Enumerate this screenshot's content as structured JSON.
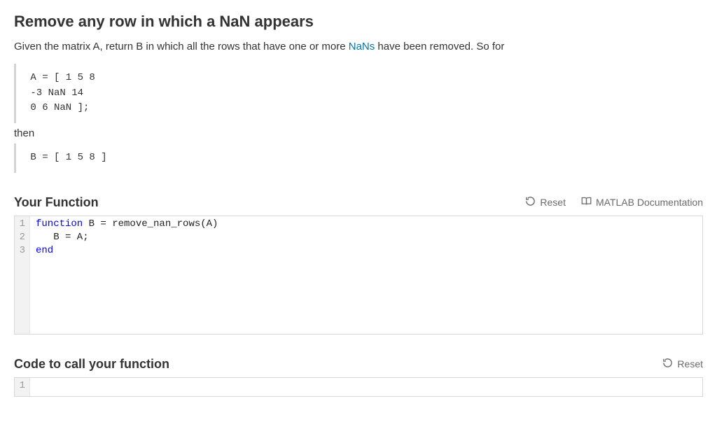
{
  "title": "Remove any row in which a NaN appears",
  "description": {
    "pre": "Given the matrix A, return B in which all the rows that have one or more ",
    "link": "NaNs",
    "post": " have been removed. So for"
  },
  "codeblock1": " A = [ 1 5 8\n -3 NaN 14\n 0 6 NaN ];",
  "then_text": "then",
  "codeblock2": " B = [ 1 5 8 ]",
  "section1": {
    "title": "Your Function",
    "reset": "Reset",
    "docs": "MATLAB Documentation",
    "lines": [
      "1",
      "2",
      "3"
    ],
    "code": {
      "l1_kw": "function",
      "l1_rest": " B = remove_nan_rows(A)",
      "l2": "   B = A;",
      "l3_kw": "end"
    }
  },
  "section2": {
    "title": "Code to call your function",
    "reset": "Reset",
    "lines": [
      "1"
    ]
  }
}
